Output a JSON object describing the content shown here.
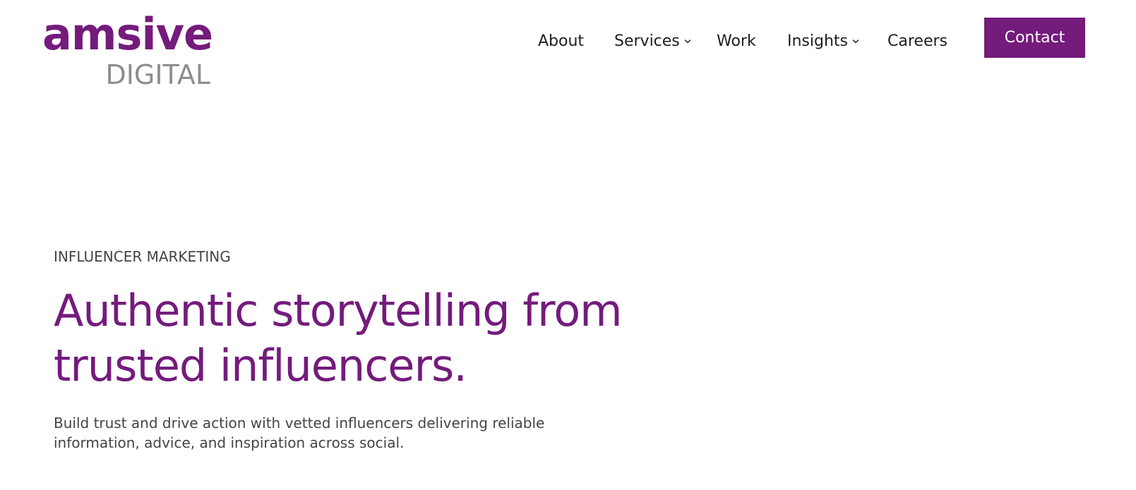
{
  "brand": {
    "wordmark": "amsive",
    "subline": "DIGITAL",
    "accent_color": "#741b7c",
    "subline_color": "#8d8d8d"
  },
  "nav": {
    "items": [
      {
        "label": "About",
        "has_dropdown": false
      },
      {
        "label": "Services",
        "has_dropdown": true,
        "icon": "chevron-down-icon"
      },
      {
        "label": "Work",
        "has_dropdown": false
      },
      {
        "label": "Insights",
        "has_dropdown": true,
        "icon": "chevron-down-icon"
      },
      {
        "label": "Careers",
        "has_dropdown": false
      }
    ],
    "contact_label": "Contact"
  },
  "hero": {
    "eyebrow": "INFLUENCER MARKETING",
    "headline": "Authentic storytelling from trusted influencers.",
    "intro": "Build trust and drive action with vetted influencers delivering reliable information, advice, and inspiration across social."
  }
}
